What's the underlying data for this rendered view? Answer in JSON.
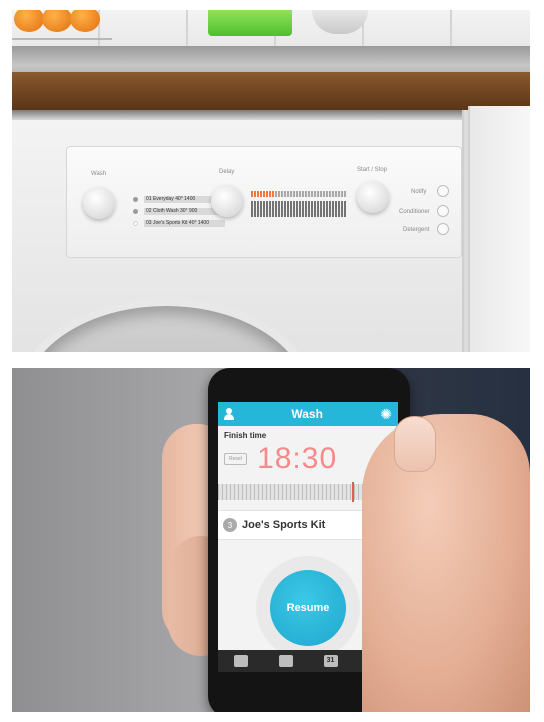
{
  "machine_panel": {
    "wash_label": "Wash",
    "delay_label": "Delay",
    "start_label": "Start / Stop",
    "notify_label": "Notify",
    "conditioner_label": "Conditioner",
    "detergent_label": "Detergent",
    "programs": [
      {
        "label": "01 Everyday",
        "temp": "40°",
        "spin": "1400",
        "active": false
      },
      {
        "label": "02 Cloth Wash",
        "temp": "30°",
        "spin": "900",
        "active": false
      },
      {
        "label": "03 Joe's Sports Kit",
        "temp": "40°",
        "spin": "1400",
        "active": true
      }
    ]
  },
  "app": {
    "title": "Wash",
    "finish_label": "Finish time",
    "reset_label": "Reset",
    "finish_time": "18:30",
    "program_number": "3",
    "program_name": "Joe's Sports Kit",
    "resume_label": "Resume",
    "calendar_day": "31"
  },
  "colors": {
    "app_accent": "#26b6d9",
    "time_color": "#f58a8a",
    "lcd_accent": "#f07a3c"
  }
}
